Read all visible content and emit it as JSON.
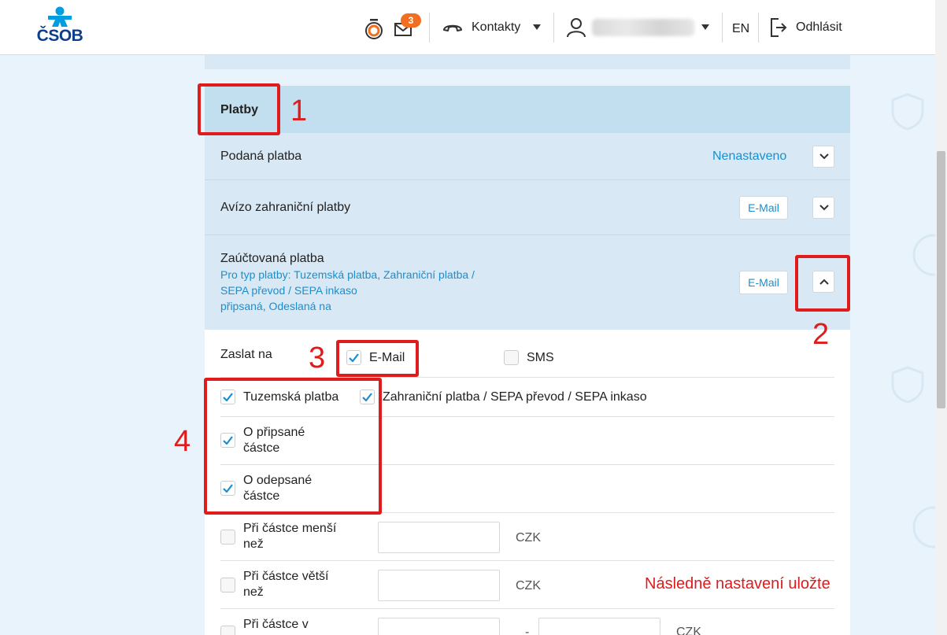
{
  "header": {
    "logo_text": "ČSOB",
    "mail_badge": "3",
    "contacts_label": "Kontakty",
    "language": "EN",
    "logout_label": "Odhlásit"
  },
  "section": {
    "title": "Platby"
  },
  "rows": [
    {
      "title": "Podaná platba",
      "value": "Nenastaveno"
    },
    {
      "title": "Avízo zahraniční platby",
      "chip": "E-Mail"
    },
    {
      "title": "Zaúčtovaná platba",
      "sub_lines": [
        "Pro typ platby: Tuzemská platba, Zahraniční platba /",
        "SEPA převod / SEPA inkaso",
        "připsaná, Odeslaná na"
      ],
      "chip": "E-Mail"
    }
  ],
  "form": {
    "send_to_label": "Zaslat na",
    "email_option": "E-Mail",
    "sms_option": "SMS",
    "domestic_label": "Tuzemská platba",
    "foreign_label": "Zahraniční platba / SEPA převod / SEPA inkaso",
    "credited_line1": "O připsané",
    "credited_line2": "částce",
    "debited_line1": "O odepsané",
    "debited_line2": "částce",
    "less_line1": "Při částce menší",
    "less_line2": "než",
    "greater_line1": "Při částce větší",
    "greater_line2": "než",
    "range_line1": "Při částce v",
    "currency": "CZK",
    "range_dash": "-"
  },
  "annotations": {
    "n1": "1",
    "n2": "2",
    "n3": "3",
    "n4": "4",
    "note": "Následně nastavení uložte",
    "color": "#e01b1b"
  }
}
